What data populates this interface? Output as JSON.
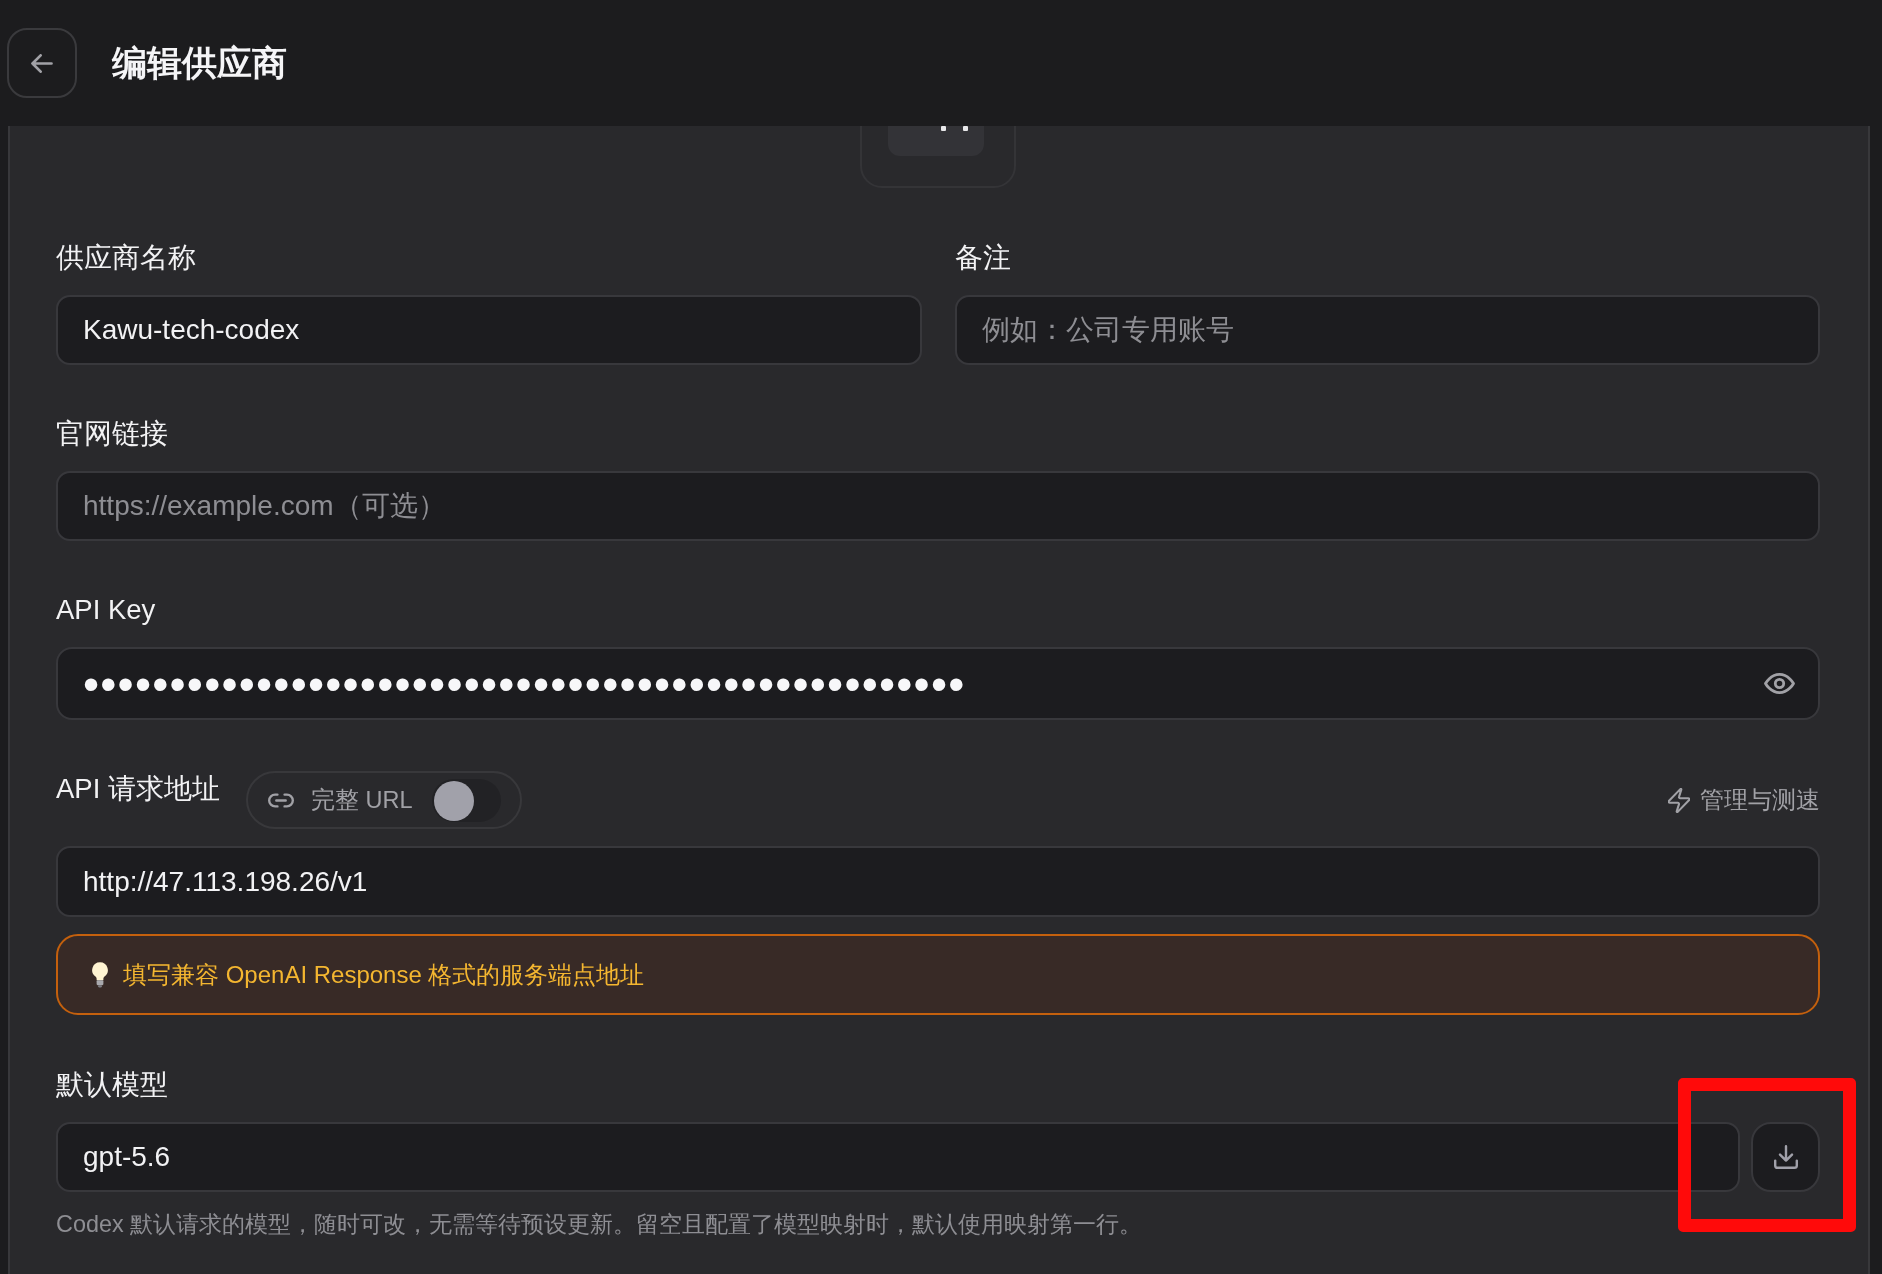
{
  "header": {
    "title": "编辑供应商"
  },
  "provider_name": {
    "label": "供应商名称",
    "value": "Kawu-tech-codex"
  },
  "notes": {
    "label": "备注",
    "placeholder": "例如：公司专用账号"
  },
  "website": {
    "label": "官网链接",
    "placeholder": "https://example.com（可选）"
  },
  "api_key": {
    "label": "API Key",
    "value": "•••••••••••••••••••••••••••••••••••••••••••••••••••"
  },
  "api_endpoint": {
    "label": "API 请求地址",
    "full_url_toggle": {
      "label": "完整 URL",
      "on": false
    },
    "manage_link": "管理与测速",
    "value": "http://47.113.198.26/v1",
    "hint": "填写兼容 OpenAI Response 格式的服务端点地址"
  },
  "default_model": {
    "label": "默认模型",
    "value": "gpt-5.6",
    "fetch_button": {
      "highlighted": true
    },
    "help_text": "Codex 默认请求的模型，随时可改，无需等待预设更新。留空且配置了模型映射时，默认使用映射第一行。"
  }
}
